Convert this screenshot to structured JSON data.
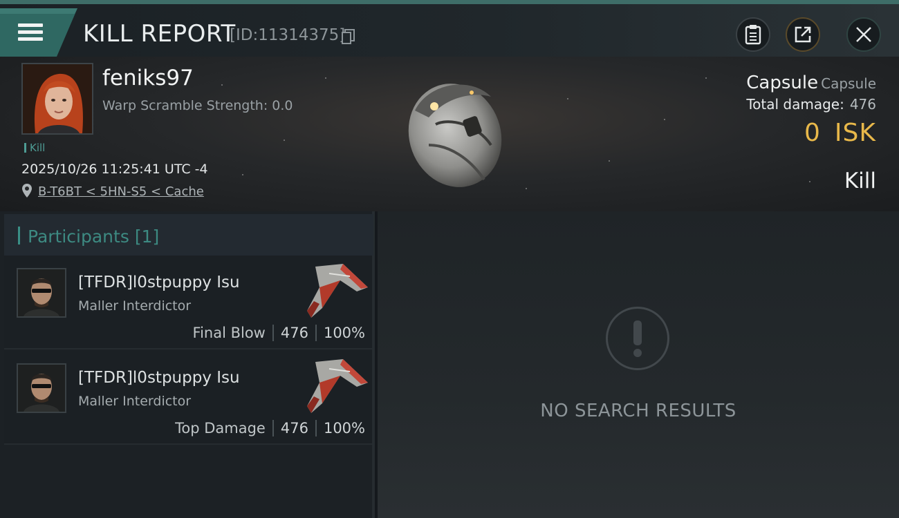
{
  "header": {
    "title": "KILL REPORT",
    "id_label": "[ID:11314375]"
  },
  "victim": {
    "name": "feniks97",
    "warp_scramble": "Warp Scramble Strength: 0.0",
    "kill_tag": "Kill",
    "datetime": "2025/10/26 11:25:41 UTC -4",
    "location": "B-T6BT < 5HN-S5 < Cache",
    "ship_name": "Capsule",
    "ship_class": "Capsule",
    "total_damage_label": "Total damage:",
    "total_damage_value": "476",
    "isk_value": "0",
    "isk_unit": "ISK",
    "result": "Kill"
  },
  "participants": {
    "header": "Participants",
    "count": "[1]",
    "rows": [
      {
        "name": "[TFDR]l0stpuppy Isu",
        "ship": "Maller Interdictor",
        "role": "Final Blow",
        "damage": "476",
        "percent": "100%"
      },
      {
        "name": "[TFDR]l0stpuppy Isu",
        "ship": "Maller Interdictor",
        "role": "Top Damage",
        "damage": "476",
        "percent": "100%"
      }
    ]
  },
  "results": {
    "empty_text": "NO SEARCH RESULTS"
  },
  "colors": {
    "accent_teal": "#3d8a82",
    "isk_gold": "#e8b84a"
  }
}
